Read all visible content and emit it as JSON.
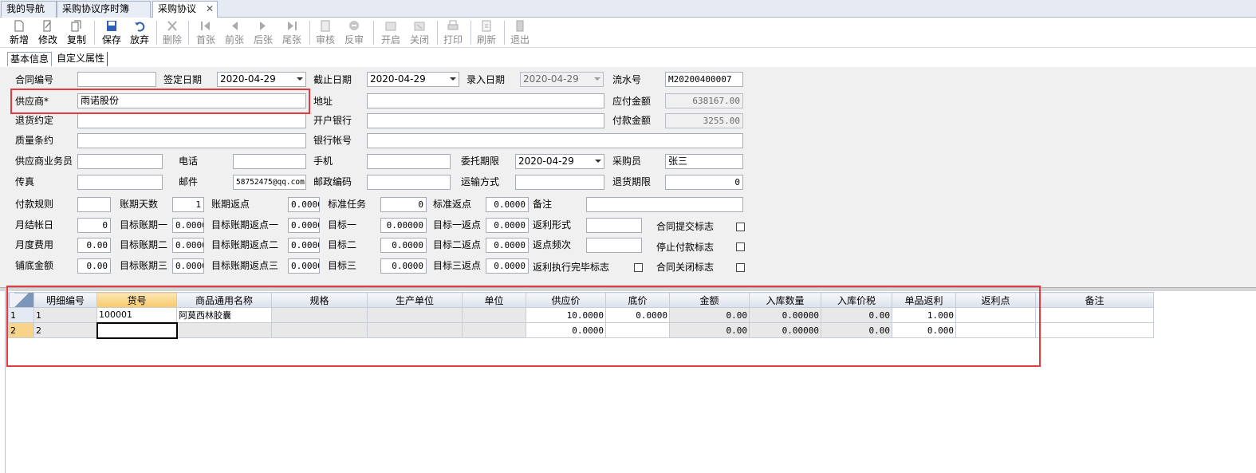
{
  "tabs": [
    {
      "label": "我的导航"
    },
    {
      "label": "采购协议序时簿"
    },
    {
      "label": "采购协议"
    }
  ],
  "toolbar": [
    {
      "label": "新增",
      "icon": "new-icon"
    },
    {
      "label": "修改",
      "icon": "edit-icon"
    },
    {
      "label": "复制",
      "icon": "copy-icon"
    },
    {
      "label": "保存",
      "icon": "save-icon"
    },
    {
      "label": "放弃",
      "icon": "undo-icon"
    },
    {
      "label": "删除",
      "icon": "delete-icon"
    },
    {
      "label": "首张",
      "icon": "first-icon"
    },
    {
      "label": "前张",
      "icon": "prev-icon"
    },
    {
      "label": "后张",
      "icon": "next-icon"
    },
    {
      "label": "尾张",
      "icon": "last-icon"
    },
    {
      "label": "审核",
      "icon": "audit-icon"
    },
    {
      "label": "反审",
      "icon": "unaudit-icon"
    },
    {
      "label": "开启",
      "icon": "open-icon"
    },
    {
      "label": "关闭",
      "icon": "close-doc-icon"
    },
    {
      "label": "打印",
      "icon": "print-icon"
    },
    {
      "label": "刷新",
      "icon": "refresh-icon"
    },
    {
      "label": "退出",
      "icon": "exit-icon"
    }
  ],
  "subtabs": {
    "basic": "基本信息",
    "custom": "自定义属性"
  },
  "form": {
    "contract_no": {
      "label": "合同编号",
      "value": ""
    },
    "sign_date": {
      "label": "签定日期",
      "value": "2020-04-29"
    },
    "end_date": {
      "label": "截止日期",
      "value": "2020-04-29"
    },
    "entry_date": {
      "label": "录入日期",
      "value": "2020-04-29"
    },
    "serial_no": {
      "label": "流水号",
      "value": "M20200400007"
    },
    "supplier": {
      "label": "供应商*",
      "value": "雨诺股份"
    },
    "address": {
      "label": "地址",
      "value": ""
    },
    "payable": {
      "label": "应付金额",
      "value": "638167.00"
    },
    "return_terms": {
      "label": "退货约定",
      "value": ""
    },
    "bank": {
      "label": "开户银行",
      "value": ""
    },
    "paid": {
      "label": "付款金额",
      "value": "3255.00"
    },
    "quality": {
      "label": "质量条约",
      "value": ""
    },
    "bank_account": {
      "label": "银行帐号",
      "value": ""
    },
    "sales_rep": {
      "label": "供应商业务员",
      "value": ""
    },
    "phone": {
      "label": "电话",
      "value": ""
    },
    "mobile": {
      "label": "手机",
      "value": ""
    },
    "entrust_period": {
      "label": "委托期限",
      "value": "2020-04-29"
    },
    "buyer": {
      "label": "采购员",
      "value": "张三"
    },
    "fax": {
      "label": "传真",
      "value": ""
    },
    "email": {
      "label": "邮件",
      "value": "58752475@qq.com"
    },
    "postcode": {
      "label": "邮政编码",
      "value": ""
    },
    "transport": {
      "label": "运输方式",
      "value": ""
    },
    "return_period": {
      "label": "退货期限",
      "value": "0"
    },
    "pay_rule": {
      "label": "付款规则",
      "value": ""
    },
    "term_days": {
      "label": "账期天数",
      "value": "1"
    },
    "term_rebate": {
      "label": "账期返点",
      "value": "0.0000"
    },
    "std_task": {
      "label": "标准任务",
      "value": "0"
    },
    "std_rebate": {
      "label": "标准返点",
      "value": "0.0000"
    },
    "remark": {
      "label": "备注",
      "value": ""
    },
    "month_day": {
      "label": "月结帐日",
      "value": "0"
    },
    "target_term1": {
      "label": "目标账期一",
      "value": "0.0000"
    },
    "target_term_rebate1": {
      "label": "目标账期返点一",
      "value": "0.0000"
    },
    "target1": {
      "label": "目标一",
      "value": "0.00000"
    },
    "target_rebate1": {
      "label": "目标一返点",
      "value": "0.0000"
    },
    "rebate_form": {
      "label": "返利形式",
      "value": ""
    },
    "contract_submit": {
      "label": "合同提交标志"
    },
    "monthly_fee": {
      "label": "月度费用",
      "value": "0.00"
    },
    "target_term2": {
      "label": "目标账期二",
      "value": "0.0000"
    },
    "target_term_rebate2": {
      "label": "目标账期返点二",
      "value": "0.0000"
    },
    "target2": {
      "label": "目标二",
      "value": "0.0000"
    },
    "target_rebate2": {
      "label": "目标二返点",
      "value": "0.0000"
    },
    "rebate_freq": {
      "label": "返点频次",
      "value": ""
    },
    "stop_pay": {
      "label": "停止付款标志"
    },
    "base_amount": {
      "label": "铺底金额",
      "value": "0.00"
    },
    "target_term3": {
      "label": "目标账期三",
      "value": "0.0000"
    },
    "target_term_rebate3": {
      "label": "目标账期返点三",
      "value": "0.0000"
    },
    "target3": {
      "label": "目标三",
      "value": "0.0000"
    },
    "target_rebate3": {
      "label": "目标三返点",
      "value": "0.0000"
    },
    "rebate_done": {
      "label": "返利执行完毕标志"
    },
    "contract_close": {
      "label": "合同关闭标志"
    }
  },
  "grid": {
    "columns": [
      "明细编号",
      "货号",
      "商品通用名称",
      "规格",
      "生产单位",
      "单位",
      "供应价",
      "底价",
      "金额",
      "入库数量",
      "入库价税",
      "单品返利",
      "返利点",
      "备注"
    ],
    "rows": [
      {
        "rn": "1",
        "cells": [
          "1",
          "100001",
          "阿莫西林胶囊",
          "",
          "",
          "",
          "10.0000",
          "0.0000",
          "0.00",
          "0.00000",
          "0.00",
          "1.000",
          "",
          ""
        ]
      },
      {
        "rn": "2",
        "cells": [
          "2",
          "",
          "",
          "",
          "",
          "",
          "0.0000",
          "",
          "0.00",
          "0.00000",
          "0.00",
          "0.000",
          "",
          ""
        ]
      }
    ]
  },
  "colors": {
    "highlight": "#e8393f",
    "header_selected": "#f7c96a"
  }
}
